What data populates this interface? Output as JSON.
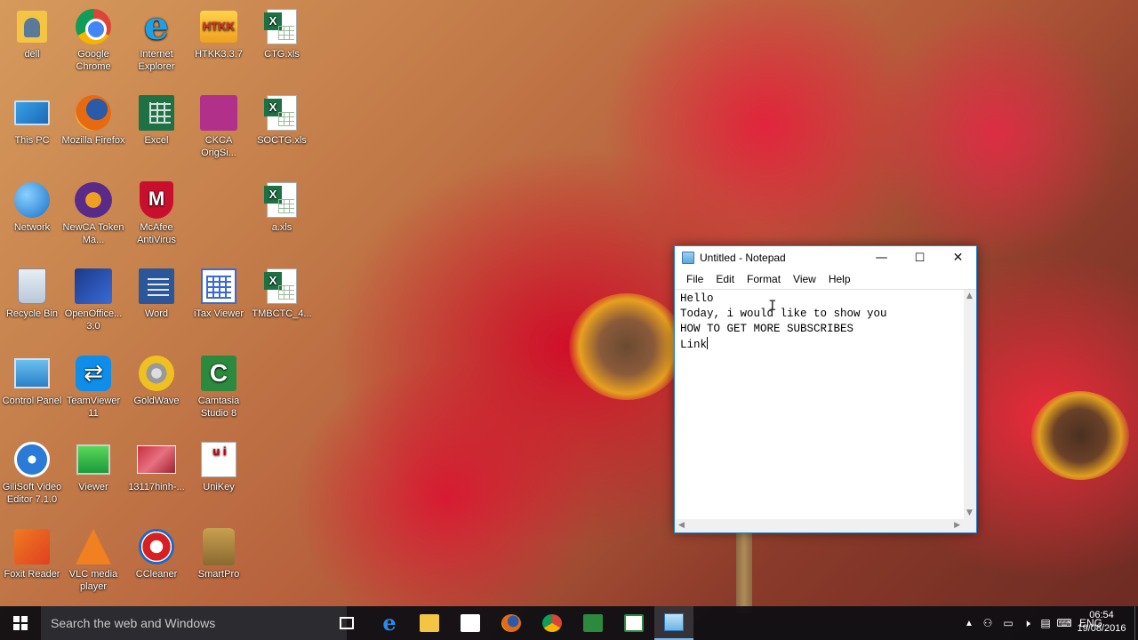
{
  "desktop": {
    "icons": [
      {
        "label": "dell",
        "icon": "user-folder-icon"
      },
      {
        "label": "Google Chrome",
        "icon": "chrome-icon"
      },
      {
        "label": "Internet Explorer",
        "icon": "internet-explorer-icon"
      },
      {
        "label": "HTKK3.3.7",
        "icon": "htkk-icon"
      },
      {
        "label": "CTG.xls",
        "icon": "excel-file-icon"
      },
      {
        "label": "This PC",
        "icon": "computer-icon"
      },
      {
        "label": "Mozilla Firefox",
        "icon": "firefox-icon"
      },
      {
        "label": "Excel",
        "icon": "excel-icon"
      },
      {
        "label": "CKCA OrigSi...",
        "icon": "ckca-icon"
      },
      {
        "label": "SOCTG.xls",
        "icon": "excel-file-icon"
      },
      {
        "label": "Network",
        "icon": "network-icon"
      },
      {
        "label": "NewCA Token Ma...",
        "icon": "newca-icon"
      },
      {
        "label": "McAfee AntiVirus",
        "icon": "mcafee-icon"
      },
      {
        "label": "a.xls",
        "icon": "excel-file-icon"
      },
      {
        "label": "Recycle Bin",
        "icon": "recycle-bin-icon"
      },
      {
        "label": "OpenOffice... 3.0",
        "icon": "openoffice-icon"
      },
      {
        "label": "Word",
        "icon": "word-icon"
      },
      {
        "label": "iTax Viewer",
        "icon": "itax-viewer-icon"
      },
      {
        "label": "TMBCTC_4...",
        "icon": "excel-file-icon"
      },
      {
        "label": "Control Panel",
        "icon": "control-panel-icon"
      },
      {
        "label": "TeamViewer 11",
        "icon": "teamviewer-icon"
      },
      {
        "label": "GoldWave",
        "icon": "goldwave-icon"
      },
      {
        "label": "Camtasia Studio 8",
        "icon": "camtasia-icon"
      },
      {
        "label": "GiliSoft Video Editor 7.1.0",
        "icon": "gilisoft-icon"
      },
      {
        "label": "Viewer",
        "icon": "viewer-icon"
      },
      {
        "label": "13117hinh-...",
        "icon": "image-file-icon"
      },
      {
        "label": "UniKey",
        "icon": "unikey-icon"
      },
      {
        "label": "Foxit Reader",
        "icon": "foxit-reader-icon"
      },
      {
        "label": "VLC media player",
        "icon": "vlc-icon"
      },
      {
        "label": "CCleaner",
        "icon": "ccleaner-icon"
      },
      {
        "label": "SmartPro",
        "icon": "smartpro-icon"
      }
    ]
  },
  "notepad": {
    "title": "Untitled - Notepad",
    "menu": [
      "File",
      "Edit",
      "Format",
      "View",
      "Help"
    ],
    "lines": [
      "Hello",
      "Today, i would like to show you",
      "HOW TO GET MORE SUBSCRIBES",
      "Link"
    ],
    "controls": {
      "minimize": "—",
      "maximize": "☐",
      "close": "✕"
    }
  },
  "taskbar": {
    "search_placeholder": "Search the web and Windows",
    "pinned": [
      "task-view-icon",
      "edge-icon",
      "file-explorer-icon",
      "store-icon",
      "firefox-icon",
      "chrome-icon",
      "camtasia-recorder-icon",
      "camtasia-icon",
      "notepad-icon"
    ],
    "tray": {
      "language": "ENG",
      "time": "06:54",
      "date": "19/08/2016"
    },
    "colors": {
      "accent": "#76b9ed",
      "background": "#101014"
    }
  }
}
